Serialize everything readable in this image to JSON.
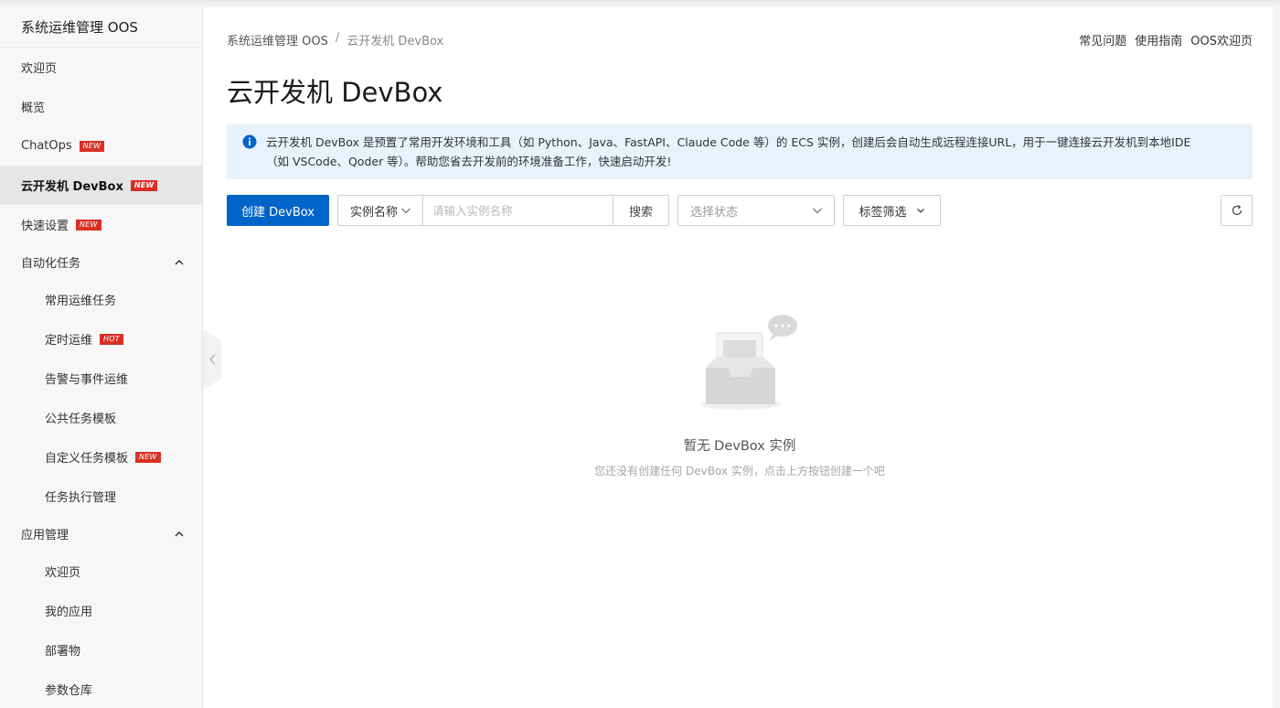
{
  "sidebar": {
    "title": "系统运维管理 OOS",
    "items": [
      {
        "label": "欢迎页"
      },
      {
        "label": "概览"
      },
      {
        "label": "ChatOps",
        "badge": "NEW"
      },
      {
        "label": "云开发机 DevBox",
        "badge": "NEW",
        "active": true
      },
      {
        "label": "快速设置",
        "badge": "NEW"
      }
    ],
    "group_automation": {
      "label": "自动化任务",
      "children": [
        {
          "label": "常用运维任务"
        },
        {
          "label": "定时运维",
          "badge": "HOT"
        },
        {
          "label": "告警与事件运维"
        },
        {
          "label": "公共任务模板"
        },
        {
          "label": "自定义任务模板",
          "badge": "NEW"
        },
        {
          "label": "任务执行管理"
        }
      ]
    },
    "group_apps": {
      "label": "应用管理",
      "children": [
        {
          "label": "欢迎页"
        },
        {
          "label": "我的应用"
        },
        {
          "label": "部署物"
        },
        {
          "label": "参数仓库"
        }
      ]
    }
  },
  "breadcrumb": {
    "root": "系统运维管理 OOS",
    "separator": "/",
    "current": "云开发机 DevBox"
  },
  "top_links": [
    "常见问题",
    "使用指南",
    "OOS欢迎页"
  ],
  "page_title": "云开发机 DevBox",
  "info": {
    "text": "云开发机 DevBox 是预置了常用开发环境和工具（如 Python、Java、FastAPI、Claude Code 等）的 ECS 实例，创建后会自动生成远程连接URL，用于一键连接云开发机到本地IDE（如 VSCode、Qoder 等）。帮助您省去开发前的环境准备工作，快速启动开发!"
  },
  "toolbar": {
    "create_label": "创建 DevBox",
    "field_select": "实例名称",
    "search_placeholder": "请输入实例名称",
    "search_label": "搜索",
    "status_placeholder": "选择状态",
    "tag_filter_label": "标签筛选"
  },
  "empty": {
    "title": "暂无 DevBox 实例",
    "subtitle": "您还没有创建任何 DevBox 实例，点击上方按钮创建一个吧"
  },
  "colors": {
    "primary": "#0064c8",
    "badge": "#d93026",
    "info_bg": "#e8f2fd",
    "info_icon": "#0064c8"
  }
}
